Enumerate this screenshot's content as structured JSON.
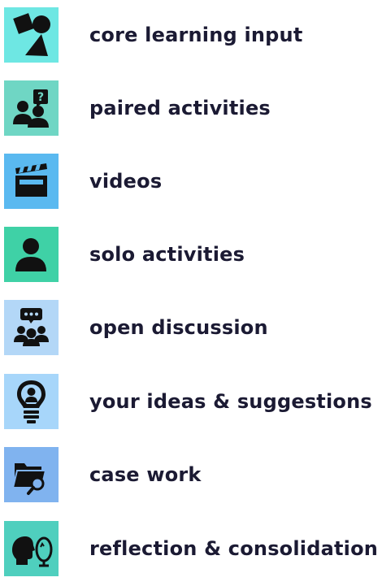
{
  "legend": {
    "items": [
      {
        "icon": "shapes-icon",
        "tile_color": "#6ee7e3",
        "label": "core learning input"
      },
      {
        "icon": "pair-question-icon",
        "tile_color": "#6fd6c4",
        "label": "paired activities"
      },
      {
        "icon": "clapperboard-icon",
        "tile_color": "#5ab9f0",
        "label": "videos"
      },
      {
        "icon": "person-icon",
        "tile_color": "#3fd1a6",
        "label": "solo activities"
      },
      {
        "icon": "group-chat-icon",
        "tile_color": "#b3d7f7",
        "label": "open discussion"
      },
      {
        "icon": "lightbulb-icon",
        "tile_color": "#a7d6fa",
        "label": "your ideas & suggestions"
      },
      {
        "icon": "folder-search-icon",
        "tile_color": "#80b3ef",
        "label": "case work"
      },
      {
        "icon": "reflection-head-icon",
        "tile_color": "#4fcfbe",
        "label": "reflection & consolidation"
      }
    ]
  }
}
